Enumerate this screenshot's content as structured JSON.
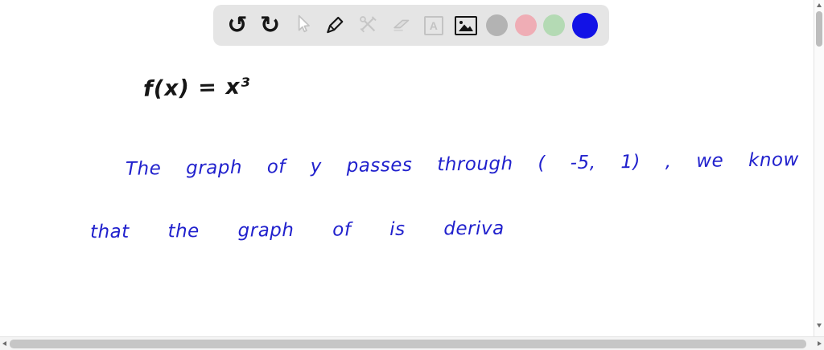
{
  "toolbar": {
    "buttons": [
      {
        "id": "undo",
        "glyph": "↺",
        "state": "enabled"
      },
      {
        "id": "redo",
        "glyph": "↻",
        "state": "enabled"
      },
      {
        "id": "select",
        "state": "disabled"
      },
      {
        "id": "pen",
        "state": "selected"
      },
      {
        "id": "tools",
        "state": "disabled"
      },
      {
        "id": "eraser",
        "state": "disabled"
      },
      {
        "id": "text",
        "label": "A",
        "state": "disabled"
      },
      {
        "id": "image",
        "state": "enabled"
      }
    ],
    "color_swatches": [
      {
        "id": "gray",
        "hex": "#b3b3b3",
        "selected": false
      },
      {
        "id": "pink",
        "hex": "#efadb5",
        "selected": false
      },
      {
        "id": "green",
        "hex": "#b4dab4",
        "selected": false
      },
      {
        "id": "blue",
        "hex": "#1212e6",
        "selected": true
      }
    ]
  },
  "canvas": {
    "ink_colors": {
      "black": "#161616",
      "blue": "#2121cd"
    },
    "handwriting": [
      {
        "line": "f(x) = x³",
        "color": "black"
      },
      {
        "line": "The graph of y passes through ( -5, 1) , we know",
        "color": "blue"
      },
      {
        "line": "that the graph of is deriva",
        "color": "blue"
      }
    ]
  }
}
